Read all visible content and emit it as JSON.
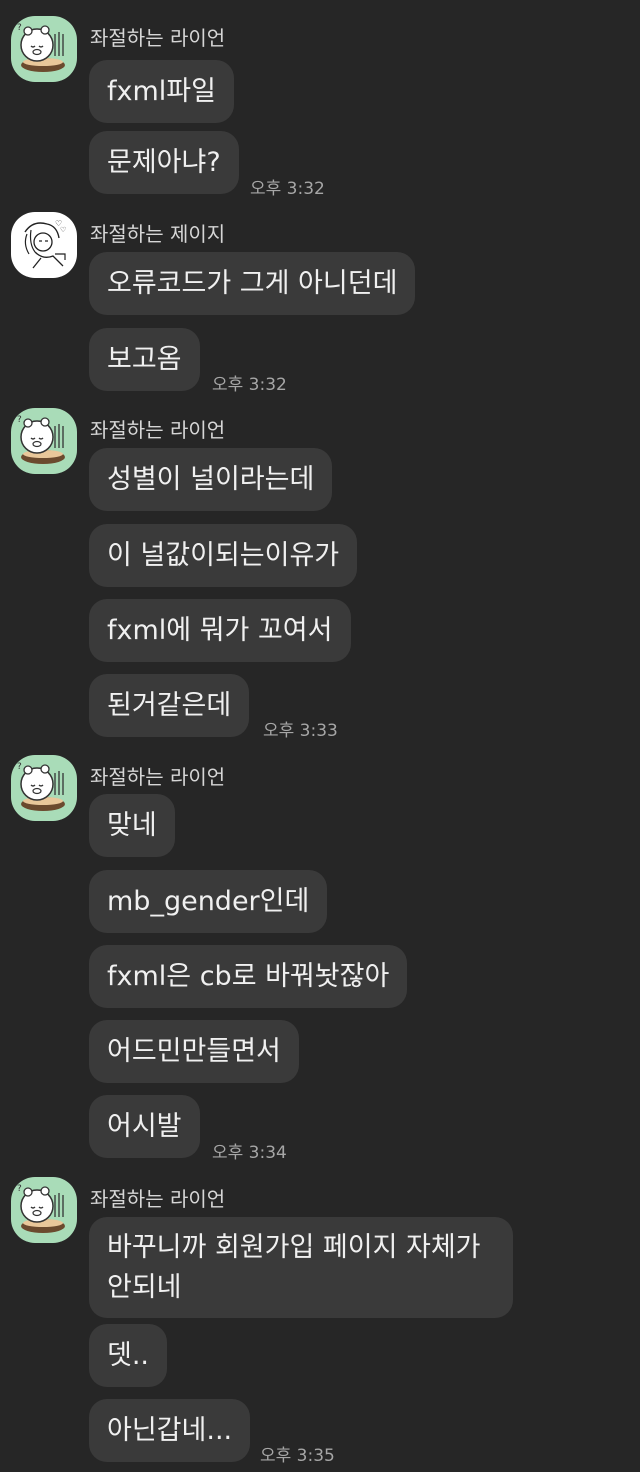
{
  "groups": [
    {
      "sender": "좌절하는 라이언",
      "avatar": "ryan-avatar",
      "messages": [
        "fxml파일",
        "문제아냐?"
      ],
      "time": "오후 3:32"
    },
    {
      "sender": "좌절하는 제이지",
      "avatar": "jayg-avatar",
      "messages": [
        "오류코드가 그게 아니던데",
        "보고옴"
      ],
      "time": "오후 3:32"
    },
    {
      "sender": "좌절하는 라이언",
      "avatar": "ryan-avatar",
      "messages": [
        "성별이 널이라는데",
        "이 널값이되는이유가",
        "fxml에 뭐가 꼬여서",
        "된거같은데"
      ],
      "time": "오후 3:33"
    },
    {
      "sender": "좌절하는 라이언",
      "avatar": "ryan-avatar",
      "messages": [
        "맞네",
        "mb_gender인데",
        "fxml은 cb로 바꿔놧잖아",
        "어드민만들면서",
        "어시발"
      ],
      "time": "오후 3:34"
    },
    {
      "sender": "좌절하는 라이언",
      "avatar": "ryan-avatar",
      "messages": [
        "바꾸니까 회원가입 페이지 자체가 안되네",
        "뎃..",
        "아닌갑네..."
      ],
      "time": "오후 3:35"
    }
  ],
  "colors": {
    "background": "#262626",
    "bubble": "#3a3a3a",
    "ryan_avatar_bg": "#a9dcb8"
  }
}
